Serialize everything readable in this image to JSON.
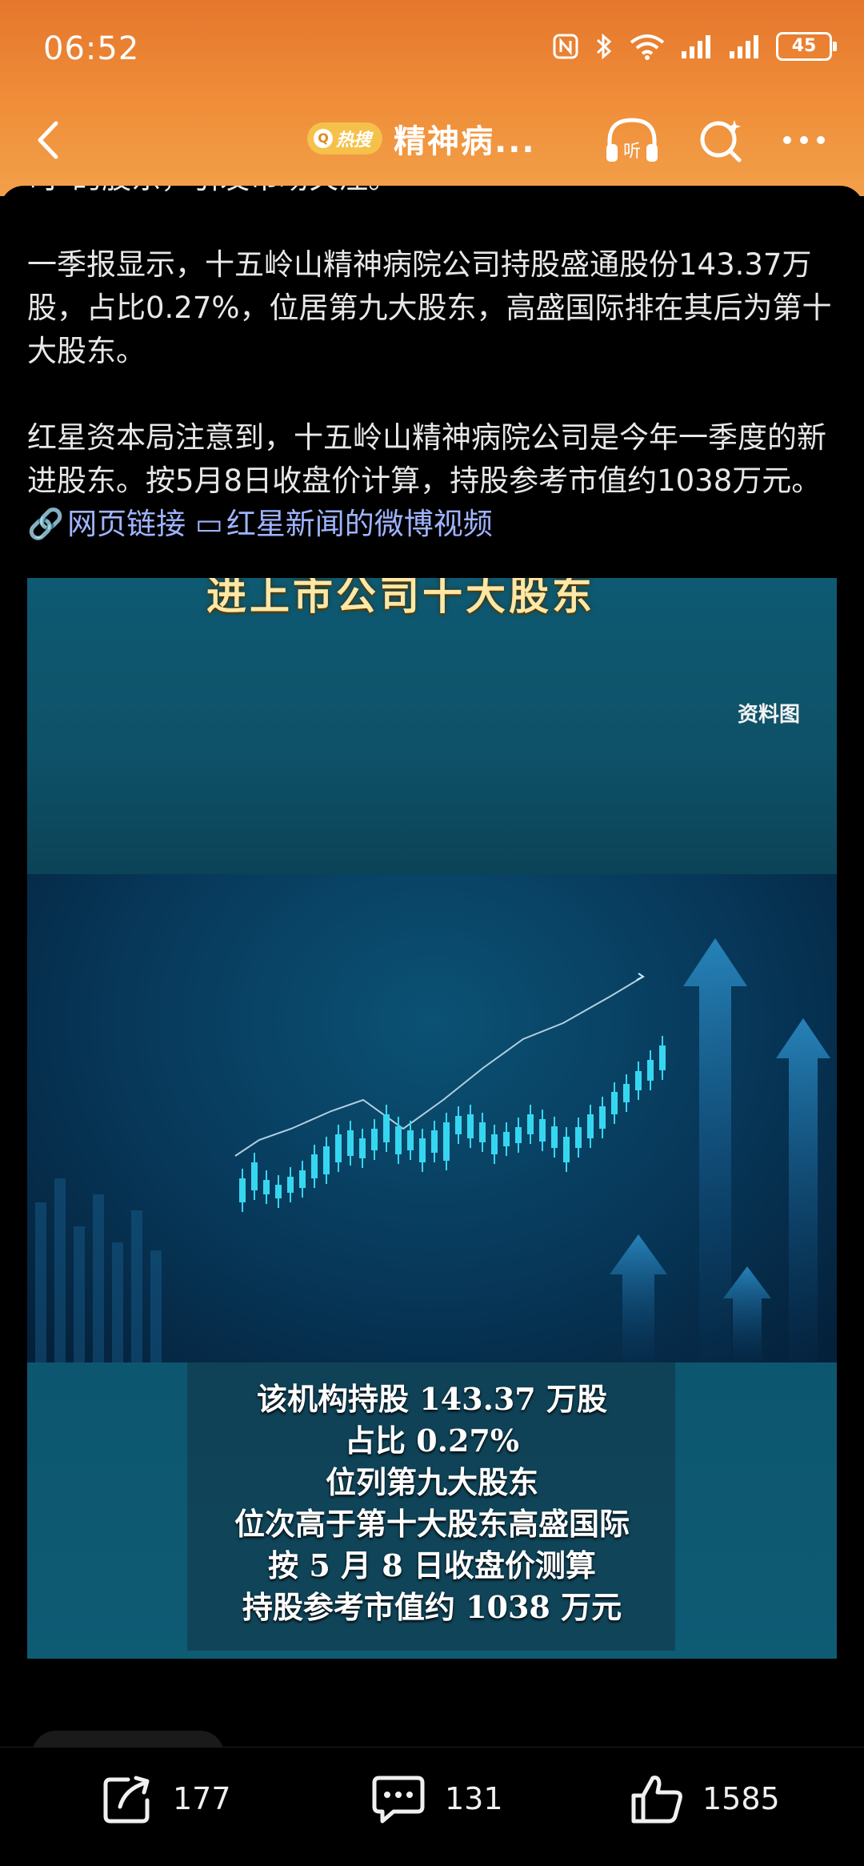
{
  "status": {
    "time": "06:52",
    "battery": "45"
  },
  "navbar": {
    "hot_label": "热搜",
    "title": "精神病..."
  },
  "article": {
    "para0": "司”的股东，引发市场关注。",
    "para1": "一季报显示，十五岭山精神病院公司持股盛通股份143.37万股，占比0.27%，位居第九大股东，高盛国际排在其后为第十大股东。",
    "para2": "红星资本局注意到，十五岭山精神病院公司是今年一季度的新进股东。按5月8日收盘价计算，持股参考市值约1038万元。",
    "link_web": "网页链接",
    "link_video": "红星新闻的微博视频"
  },
  "image": {
    "title": "进上市公司十大股东",
    "source": "资料图",
    "caption": [
      "该机构持股 143.37 万股",
      "占比 0.27%",
      "位列第九大股东",
      "位次高于第十大股东高盛国际",
      "按 5 月 8 日收盘价测算",
      "持股参考市值约 1038 万元"
    ]
  },
  "actions": {
    "share_count": "177",
    "comment_count": "131",
    "like_count": "1585"
  },
  "colors": {
    "header_gradient_start": "#e5762c",
    "header_gradient_end": "#f2a04a",
    "link": "#9fb4ff",
    "candle": "#37d6f0"
  },
  "icons": {
    "back": "chevron-left-icon",
    "listen": "headphones-icon",
    "search": "search-icon",
    "more": "more-icon",
    "share": "share-icon",
    "comment": "comment-icon",
    "like": "thumbs-up-icon"
  }
}
